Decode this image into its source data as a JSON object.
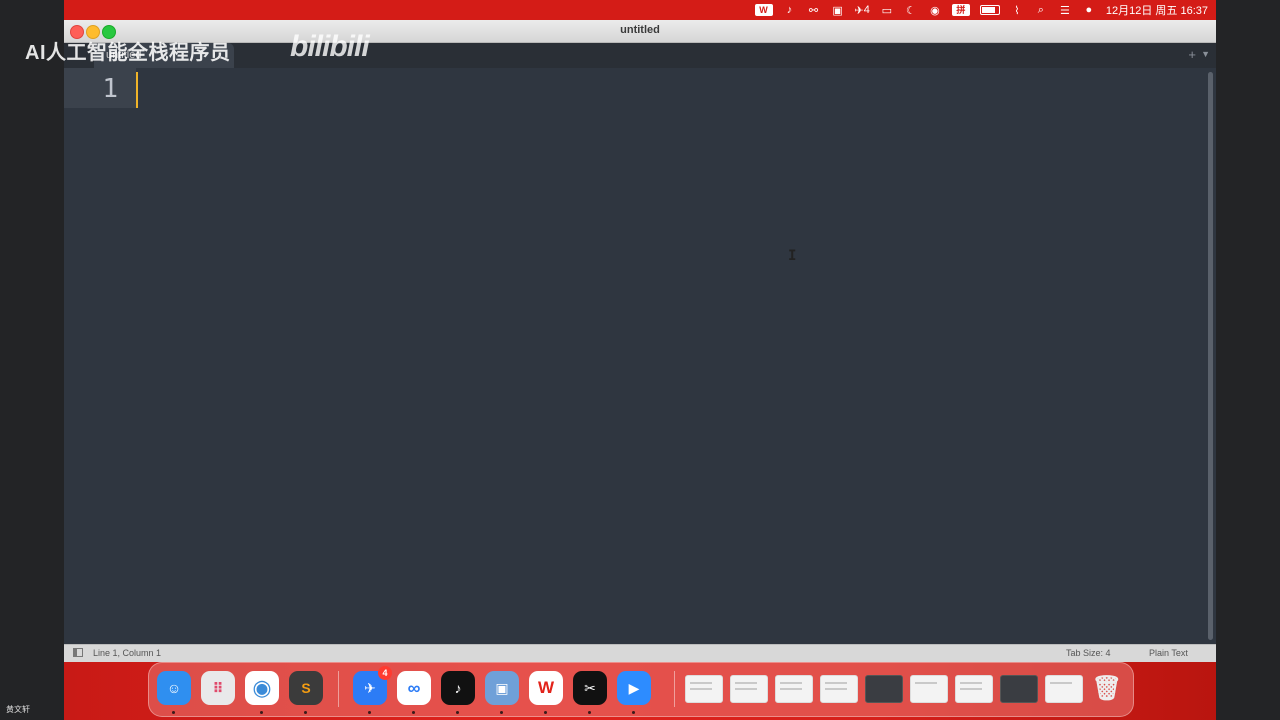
{
  "menubar": {
    "items": [
      "W",
      "tiktok",
      "link",
      "notes",
      "4",
      "display",
      "moon",
      "play",
      "拼"
    ],
    "datetime": "12月12日 周五 16:37"
  },
  "window": {
    "title": "untitled",
    "tab": {
      "label": "untitled"
    }
  },
  "editor": {
    "line_number": "1",
    "content": ""
  },
  "statusbar": {
    "position": "Line 1, Column 1",
    "tab_size": "Tab Size: 4",
    "syntax": "Plain Text"
  },
  "dock": {
    "apps": [
      {
        "name": "Finder",
        "color": "#2f8ff0",
        "glyph": "☺"
      },
      {
        "name": "Launchpad",
        "color": "#e9e9ea",
        "glyph": "⠿"
      },
      {
        "name": "Chrome",
        "color": "#ffffff",
        "glyph": "◉"
      },
      {
        "name": "Sublime Text",
        "color": "#3b3b3b",
        "glyph": "S"
      },
      {
        "name": "Feishu",
        "color": "#2c7cf6",
        "glyph": "✈",
        "badge": "4"
      },
      {
        "name": "Baidu Netdisk",
        "color": "#ffffff",
        "glyph": "∞"
      },
      {
        "name": "TikTok",
        "color": "#111111",
        "glyph": "♪"
      },
      {
        "name": "Preview",
        "color": "#6fa0d8",
        "glyph": "▣"
      },
      {
        "name": "WPS",
        "color": "#ffffff",
        "glyph": "W"
      },
      {
        "name": "CapCut",
        "color": "#111111",
        "glyph": "✂"
      },
      {
        "name": "Zoom",
        "color": "#2d8cff",
        "glyph": "▶"
      }
    ]
  },
  "watermark": {
    "text": "AI人工智能全栈程序员",
    "logo": "bilibili"
  },
  "user_label": "黄文轩",
  "colors": {
    "editor_bg": "#2f3640",
    "cursor": "#f0b429",
    "menubar": "#d41c17"
  }
}
